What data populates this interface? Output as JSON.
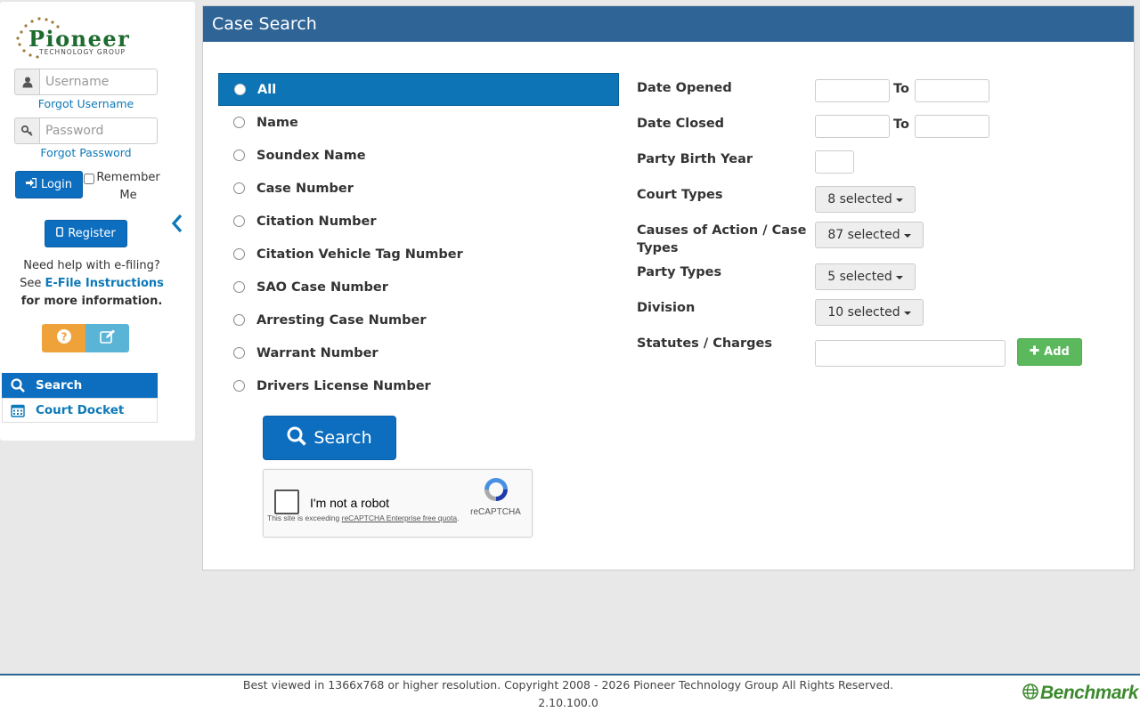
{
  "brand": {
    "logo_name": "Pioneer",
    "logo_sub": "TECHNOLOGY GROUP"
  },
  "login": {
    "username_placeholder": "Username",
    "forgot_username": "Forgot Username",
    "password_placeholder": "Password",
    "forgot_password": "Forgot Password",
    "login_label": "Login",
    "remember_label": "Remember Me",
    "register_label": "Register"
  },
  "help": {
    "line1": "Need help with e-filing?",
    "see": "See ",
    "link": "E-File Instructions",
    "line3": "for more information."
  },
  "nav": {
    "search": "Search",
    "court_docket": "Court Docket"
  },
  "panel": {
    "title": "Case Search"
  },
  "search_types": [
    {
      "label": "All",
      "selected": true
    },
    {
      "label": "Name",
      "selected": false
    },
    {
      "label": "Soundex Name",
      "selected": false
    },
    {
      "label": "Case Number",
      "selected": false
    },
    {
      "label": "Citation Number",
      "selected": false
    },
    {
      "label": "Citation Vehicle Tag Number",
      "selected": false
    },
    {
      "label": "SAO Case Number",
      "selected": false
    },
    {
      "label": "Arresting Case Number",
      "selected": false
    },
    {
      "label": "Warrant Number",
      "selected": false
    },
    {
      "label": "Drivers License Number",
      "selected": false
    }
  ],
  "search_button": "Search",
  "recaptcha": {
    "label": "I'm not a robot",
    "brand": "reCAPTCHA",
    "note_prefix": "This site is exceeding ",
    "note_link": "reCAPTCHA Enterprise free quota",
    "note_suffix": "."
  },
  "filters": {
    "date_opened": "Date Opened",
    "date_closed": "Date Closed",
    "to": "To",
    "party_birth_year": "Party Birth Year",
    "court_types": "Court Types",
    "court_types_value": "8 selected",
    "causes": "Causes of Action / Case Types",
    "causes_value": "87 selected",
    "party_types": "Party Types",
    "party_types_value": "5 selected",
    "division": "Division",
    "division_value": "10 selected",
    "statutes": "Statutes / Charges",
    "add_label": "Add"
  },
  "footer": {
    "copyright": "Best viewed in 1366x768 or higher resolution. Copyright 2008 - 2026 Pioneer Technology Group All Rights Reserved.",
    "version": "2.10.100.0",
    "benchmark": "Benchmark"
  },
  "colors": {
    "header": "#2f6496",
    "primary": "#0d6ebf",
    "success": "#5cb85c",
    "warning": "#f0a23a",
    "info": "#5ab4d6"
  }
}
